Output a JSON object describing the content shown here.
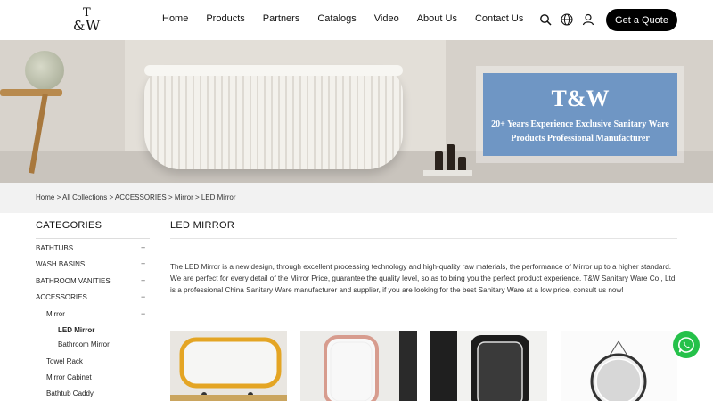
{
  "header": {
    "logo": {
      "t": "T",
      "amp": "&",
      "w": "W"
    },
    "nav": [
      "Home",
      "Products",
      "Partners",
      "Catalogs",
      "Video",
      "About Us",
      "Contact Us"
    ],
    "icons": [
      "search-icon",
      "globe-icon",
      "user-icon"
    ],
    "quote_button": "Get a Quote"
  },
  "banner": {
    "brand": "T&W",
    "line1": "20+ Years Experience Exclusive Sanitary Ware",
    "line2": "Products Professional Manufacturer"
  },
  "breadcrumb": "Home > All Collections > ACCESSORIES > Mirror > LED Mirror",
  "sidebar": {
    "title": "CATEGORIES",
    "items": [
      {
        "label": "BATHTUBS",
        "sign": "+"
      },
      {
        "label": "WASH BASINS",
        "sign": "+"
      },
      {
        "label": "BATHROOM VANITIES",
        "sign": "+"
      },
      {
        "label": "ACCESSORIES",
        "sign": "−"
      },
      {
        "label": "Mirror",
        "sign": "−"
      },
      {
        "label": "LED Mirror",
        "sign": ""
      },
      {
        "label": "Bathroom Mirror",
        "sign": ""
      },
      {
        "label": "Towel Rack",
        "sign": ""
      },
      {
        "label": "Mirror Cabinet",
        "sign": ""
      },
      {
        "label": "Bathtub Caddy",
        "sign": ""
      }
    ]
  },
  "main": {
    "title": "LED MIRROR",
    "description": "The LED Mirror is a new design, through excellent processing technology and high-quality raw materials, the performance of Mirror up to a higher standard. We are perfect for every detail of the Mirror Price, guarantee the quality level, so as to bring you the perfect product experience. T&W Sanitary Ware Co., Ltd is a professional China Sanitary Ware manufacturer and supplier, if you are looking for the best Sanitary Ware at a low price, consult us now!"
  },
  "colors": {
    "accent": "#000000",
    "banner_box": "#6f96c4",
    "whatsapp": "#25c14a"
  }
}
